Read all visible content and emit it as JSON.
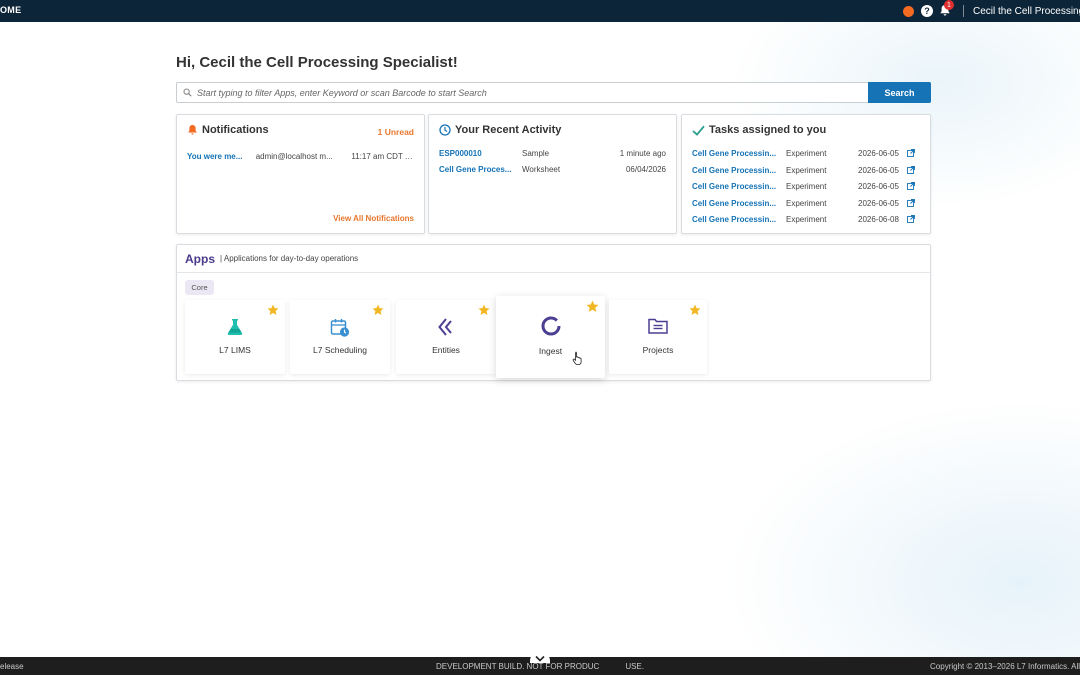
{
  "topbar": {
    "brand": "OME",
    "notification_count": "1",
    "user_name": "Cecil the Cell Processing Sp"
  },
  "greeting": "Hi, Cecil the Cell Processing Specialist!",
  "search": {
    "placeholder": "Start typing to filter Apps, enter Keyword or scan Barcode to start Search",
    "button": "Search"
  },
  "notifications": {
    "title": "Notifications",
    "unread": "1 Unread",
    "items": [
      {
        "text": "You were me...",
        "from": "admin@localhost m...",
        "time": "11:17 am CDT T..."
      }
    ],
    "view_all": "View All Notifications"
  },
  "recent_activity": {
    "title": "Your Recent Activity",
    "items": [
      {
        "name": "ESP000010",
        "type": "Sample",
        "when": "1 minute ago"
      },
      {
        "name": "Cell Gene Proces...",
        "type": "Worksheet",
        "when": "06/04/2026"
      }
    ]
  },
  "tasks": {
    "title": "Tasks assigned to you",
    "items": [
      {
        "name": "Cell Gene Processin...",
        "type": "Experiment",
        "date": "2026-06-05"
      },
      {
        "name": "Cell Gene Processin...",
        "type": "Experiment",
        "date": "2026-06-05"
      },
      {
        "name": "Cell Gene Processin...",
        "type": "Experiment",
        "date": "2026-06-05"
      },
      {
        "name": "Cell Gene Processin...",
        "type": "Experiment",
        "date": "2026-06-05"
      },
      {
        "name": "Cell Gene Processin...",
        "type": "Experiment",
        "date": "2026-06-08"
      }
    ]
  },
  "apps": {
    "title": "Apps",
    "subtitle": "| Applications for day-to-day operations",
    "category": "Core",
    "tiles": [
      {
        "label": "L7 LIMS",
        "icon": "flask-icon"
      },
      {
        "label": "L7 Scheduling",
        "icon": "calendar-clock-icon"
      },
      {
        "label": "Entities",
        "icon": "chevrons-icon"
      },
      {
        "label": "Ingest",
        "icon": "loading-ring-icon"
      },
      {
        "label": "Projects",
        "icon": "folder-list-icon"
      }
    ]
  },
  "footer": {
    "left": "elease",
    "center": "DEVELOPMENT BUILD. NOT FOR PRODUC",
    "center_tail": "USE.",
    "right": "Copyright © 2013–2026 L7 Informatics. All"
  },
  "colors": {
    "topbar": "#0d2538",
    "primary": "#1573b6",
    "accent": "#e8772e",
    "apps_title": "#4a3a8c",
    "star": "#f2b824"
  }
}
